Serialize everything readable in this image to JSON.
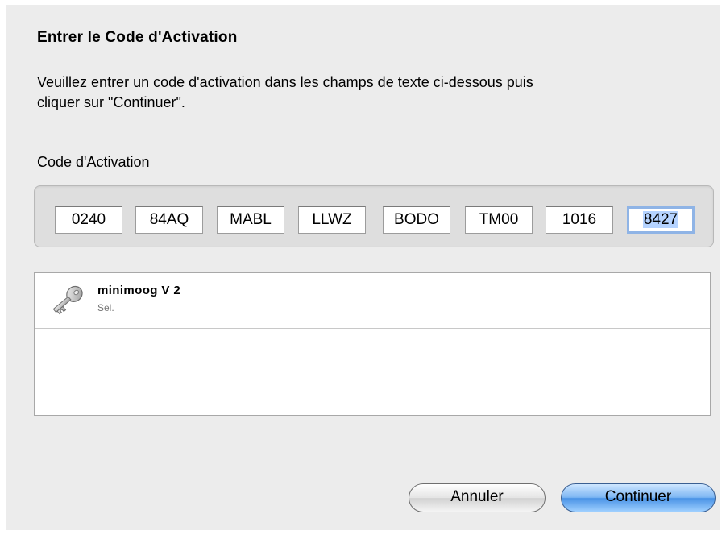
{
  "dialog": {
    "title": "Entrer le Code d'Activation",
    "instructions": "Veuillez entrer un code d'activation dans les champs de texte ci-dessous puis\ncliquer sur \"Continuer\".",
    "code_label": "Code d'Activation"
  },
  "code_fields": [
    {
      "value": "0240"
    },
    {
      "value": "84AQ"
    },
    {
      "value": "MABL"
    },
    {
      "value": "LLWZ"
    },
    {
      "value": "BODO"
    },
    {
      "value": "TM00"
    },
    {
      "value": "1016"
    },
    {
      "value": "8427",
      "focused": true,
      "selected": true
    }
  ],
  "products": [
    {
      "name": "minimoog V 2",
      "subtitle": "Sel.",
      "icon": "key-icon"
    }
  ],
  "buttons": {
    "cancel_label": "Annuler",
    "continue_label": "Continuer",
    "default_color": "#4a93e6"
  }
}
